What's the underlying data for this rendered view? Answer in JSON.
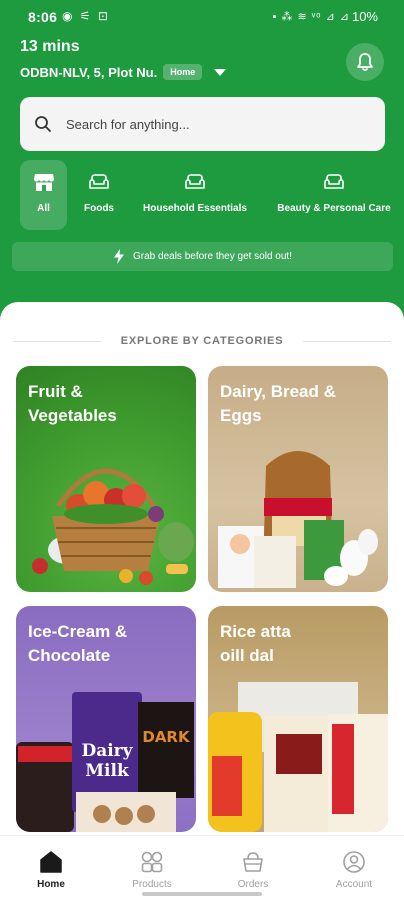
{
  "status_bar": {
    "time": "8:06",
    "left_icons": "◉ ⚟ ⊡",
    "right_icons": "▪ ⁂ ≋ ᵛᵒ ⊿ ⊿",
    "battery": "10%",
    "icons": [
      "whatsapp-icon",
      "phone-icon",
      "lock-icon",
      "mute-icon",
      "wifi-icon",
      "signal-icon",
      "battery-icon"
    ]
  },
  "header": {
    "delivery_time": "13 mins",
    "address": "ODBN-NLV, 5, Plot Nu.",
    "address_badge": "Home",
    "bell_icon": "bell-icon",
    "background_color": "#1e9a3f"
  },
  "search": {
    "placeholder": "Search for anything...",
    "value": ""
  },
  "category_tabs": [
    {
      "label": "All",
      "icon": "store-icon",
      "active": true
    },
    {
      "label": "Foods",
      "icon": "sofa-icon",
      "active": false
    },
    {
      "label": "Household Essentials",
      "icon": "sofa-icon",
      "active": false
    },
    {
      "label": "Beauty & Personal Care",
      "icon": "sofa-icon",
      "active": false
    }
  ],
  "deals_banner": {
    "text": "Grab deals before they get sold out!",
    "icon": "lightning-icon"
  },
  "explore": {
    "heading": "EXPLORE BY CATEGORIES",
    "cards": [
      {
        "title": "Fruit &\nVegetables",
        "color": "#3f9b2e"
      },
      {
        "title": "Dairy, Bread &\nEggs",
        "color": "#c9b18b"
      },
      {
        "title": "Ice-Cream &\nChocolate",
        "color": "#8c6fc4"
      },
      {
        "title": "Rice atta\noill dal",
        "color": "#bfa46f"
      }
    ]
  },
  "bottom_nav": [
    {
      "label": "Home",
      "icon": "home-icon",
      "active": true
    },
    {
      "label": "Products",
      "icon": "grid-icon",
      "active": false
    },
    {
      "label": "Orders",
      "icon": "basket-icon",
      "active": false
    },
    {
      "label": "Account",
      "icon": "user-icon",
      "active": false
    }
  ],
  "colors": {
    "brand_green": "#1e9a3f",
    "inactive_nav": "#a0a0a0"
  }
}
